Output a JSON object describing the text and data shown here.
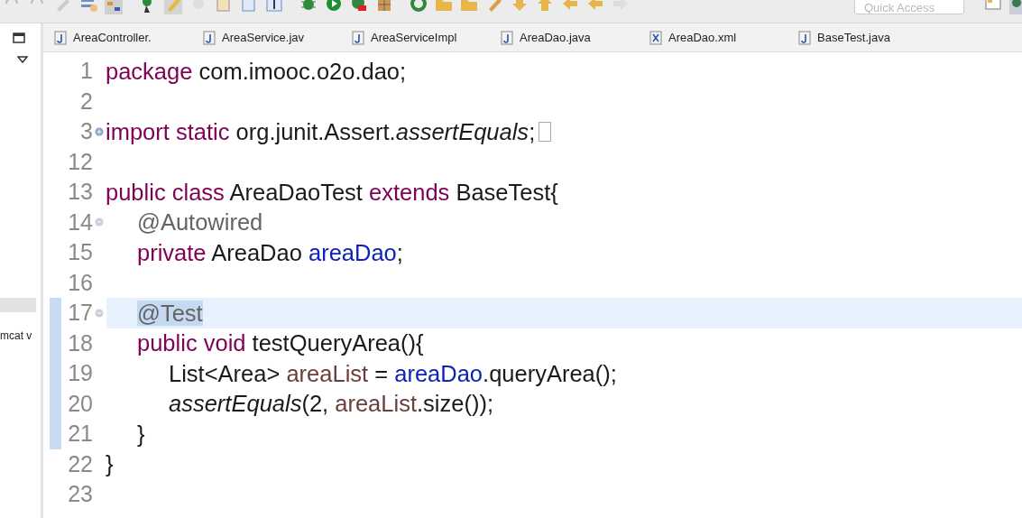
{
  "toolbar": {
    "quick_access": {
      "placeholder": "Quick Access"
    }
  },
  "tabs": [
    {
      "label": "AreaController.",
      "kind": "java"
    },
    {
      "label": "AreaService.jav",
      "kind": "java"
    },
    {
      "label": "AreaServiceImpl",
      "kind": "java"
    },
    {
      "label": "AreaDao.java",
      "kind": "java"
    },
    {
      "label": "AreaDao.xml",
      "kind": "xml"
    },
    {
      "label": "BaseTest.java",
      "kind": "java"
    }
  ],
  "left_panel": {
    "items": [
      {
        "label": "mcat v"
      }
    ]
  },
  "editor": {
    "lines": [
      {
        "number": "1",
        "foldable": false,
        "folded": false,
        "current": false,
        "changed": false,
        "tokens": [
          {
            "kind": "keyword",
            "text": "package"
          },
          {
            "kind": "plain",
            "text": " com.imooc.o2o.dao;"
          }
        ]
      },
      {
        "number": "2",
        "foldable": false,
        "folded": false,
        "current": false,
        "changed": false
      },
      {
        "number": "3",
        "foldable": true,
        "folded": true,
        "current": false,
        "changed": false,
        "tokens": [
          {
            "kind": "keyword",
            "text": "import static"
          },
          {
            "kind": "plain",
            "text": " org.junit.Assert."
          },
          {
            "kind": "static",
            "text": "assertEquals"
          },
          {
            "kind": "plain",
            "text": ";"
          }
        ]
      },
      {
        "number": "12",
        "foldable": false,
        "folded": false,
        "current": false,
        "changed": false
      },
      {
        "number": "13",
        "foldable": false,
        "folded": false,
        "current": false,
        "changed": false,
        "tokens": [
          {
            "kind": "keyword",
            "text": "public class"
          },
          {
            "kind": "plain",
            "text": " AreaDaoTest "
          },
          {
            "kind": "keyword",
            "text": "extends"
          },
          {
            "kind": "plain",
            "text": " BaseTest{"
          }
        ]
      },
      {
        "number": "14",
        "foldable": true,
        "folded": false,
        "current": false,
        "changed": false,
        "tokens": [
          {
            "kind": "annotation",
            "text": "\t@Autowired"
          }
        ]
      },
      {
        "number": "15",
        "foldable": false,
        "folded": false,
        "current": false,
        "changed": false,
        "tokens": [
          {
            "kind": "keyword",
            "text": "\tprivate"
          },
          {
            "kind": "plain",
            "text": " AreaDao "
          },
          {
            "kind": "field",
            "text": "areaDao"
          },
          {
            "kind": "plain",
            "text": ";"
          }
        ]
      },
      {
        "number": "16",
        "foldable": false,
        "folded": false,
        "current": false,
        "changed": false
      },
      {
        "number": "17",
        "foldable": true,
        "folded": false,
        "current": true,
        "changed": true,
        "tokens": [
          {
            "kind": "marked",
            "text": "\t@Test"
          }
        ]
      },
      {
        "number": "18",
        "foldable": false,
        "folded": false,
        "current": false,
        "changed": true,
        "tokens": [
          {
            "kind": "keyword",
            "text": "\tpublic void"
          },
          {
            "kind": "plain",
            "text": " testQueryArea(){"
          }
        ]
      },
      {
        "number": "19",
        "foldable": false,
        "folded": false,
        "current": false,
        "changed": true,
        "tokens": [
          {
            "kind": "plain",
            "text": "\t\tList<Area> "
          },
          {
            "kind": "local",
            "text": "areaList"
          },
          {
            "kind": "plain",
            "text": " = "
          },
          {
            "kind": "field",
            "text": "areaDao"
          },
          {
            "kind": "plain",
            "text": ".queryArea();"
          }
        ]
      },
      {
        "number": "20",
        "foldable": false,
        "folded": false,
        "current": false,
        "changed": true,
        "tokens": [
          {
            "kind": "static",
            "text": "\t\tassertEquals"
          },
          {
            "kind": "plain",
            "text": "(2, "
          },
          {
            "kind": "local",
            "text": "areaList"
          },
          {
            "kind": "plain",
            "text": ".size());"
          }
        ]
      },
      {
        "number": "21",
        "foldable": false,
        "folded": false,
        "current": false,
        "changed": true,
        "tokens": [
          {
            "kind": "plain",
            "text": "\t}"
          }
        ]
      },
      {
        "number": "22",
        "foldable": false,
        "folded": false,
        "current": false,
        "changed": false,
        "tokens": [
          {
            "kind": "plain",
            "text": "}"
          }
        ]
      },
      {
        "number": "23",
        "foldable": false,
        "folded": false,
        "current": false,
        "changed": false
      }
    ]
  }
}
